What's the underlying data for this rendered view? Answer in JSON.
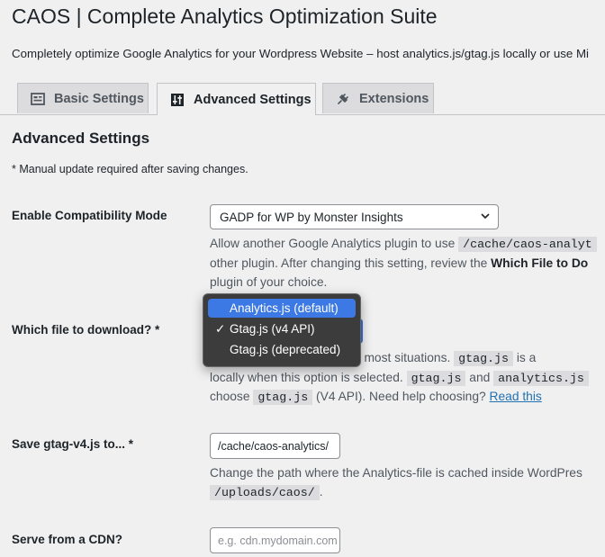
{
  "page": {
    "title": "CAOS | Complete Analytics Optimization Suite",
    "subtitle": "Completely optimize Google Analytics for your Wordpress Website – host analytics.js/gtag.js locally or use Mi"
  },
  "tabs": [
    {
      "label": "Basic Settings",
      "icon": "settings-panel-icon",
      "active": false
    },
    {
      "label": "Advanced Settings",
      "icon": "sliders-icon",
      "active": true
    },
    {
      "label": "Extensions",
      "icon": "plugin-icon",
      "active": false
    }
  ],
  "section": {
    "heading": "Advanced Settings",
    "note": "* Manual update required after saving changes."
  },
  "compat": {
    "label": "Enable Compatibility Mode",
    "value": "GADP for WP by Monster Insights",
    "desc1_pre": "Allow another Google Analytics plugin to use ",
    "desc1_code": "/cache/caos-analyt",
    "desc2_pre": "other plugin. After changing this setting, review the ",
    "desc2_bold": "Which File to Do",
    "desc3": "plugin of your choice."
  },
  "file": {
    "label": "Which file to download? *",
    "options": [
      "Analytics.js (default)",
      "Gtag.js (v4 API)",
      "Gtag.js (deprecated)"
    ],
    "checkmark": "✓",
    "desc1_pre": "nended in most situations. ",
    "desc1_code": "gtag.js",
    "desc1_post": " is a",
    "desc2_pre": "locally when this option is selected. ",
    "desc2_code1": "gtag.js",
    "desc2_mid": " and ",
    "desc2_code2": "analytics.js",
    "desc3_pre": "choose ",
    "desc3_code": "gtag.js",
    "desc3_post": " (V4 API). Need help choosing? ",
    "desc3_link": "Read this"
  },
  "save_path": {
    "label": "Save gtag-v4.js to... *",
    "value": "/cache/caos-analytics/",
    "desc1": "Change the path where the Analytics-file is cached inside WordPres",
    "desc2_code": "/uploads/caos/",
    "desc2_post": "."
  },
  "cdn": {
    "label": "Serve from a CDN?",
    "placeholder": "e.g. cdn.mydomain.com"
  }
}
